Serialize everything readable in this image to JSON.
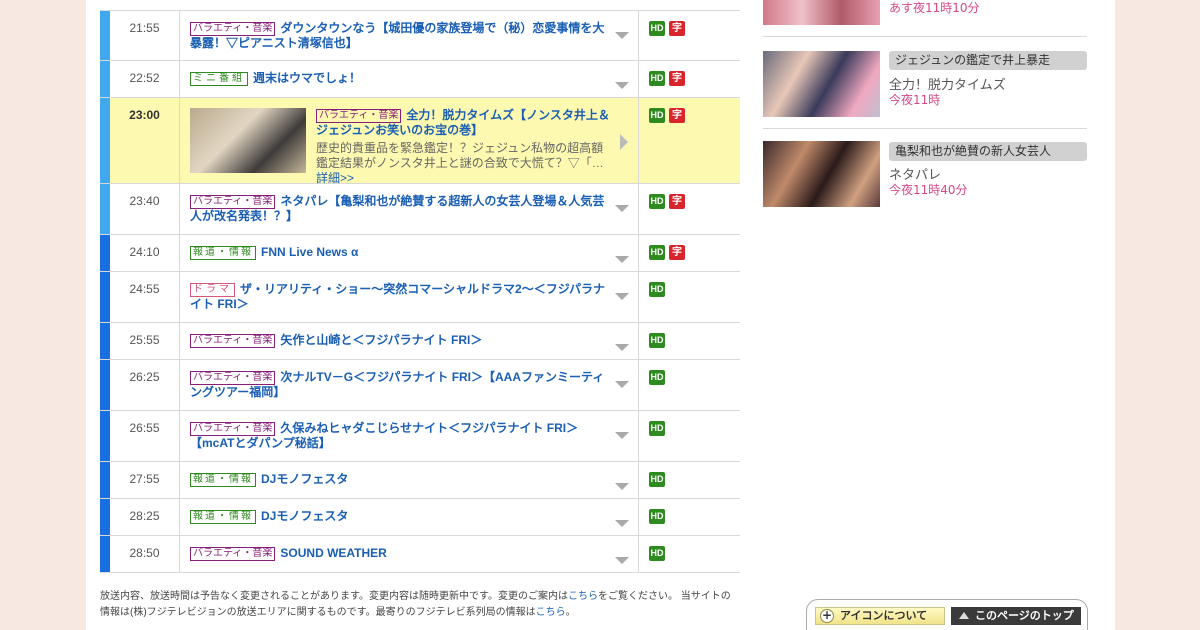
{
  "schedule": [
    {
      "time": "21:55",
      "bar": "#3fa8ef",
      "category": "バラエティ・音楽",
      "cat_class": "var",
      "title": "ダウンタウンなう【城田優の家族登場で（秘）恋愛事情を大暴露！▽ピアニスト清塚信也】",
      "hd": "HD",
      "ji": "字",
      "height": 51
    },
    {
      "time": "22:52",
      "bar": "#3fa8ef",
      "category": "ミニ番組",
      "cat_class": "mini",
      "title": "週末はウマでしょ！",
      "hd": "HD",
      "ji": "字",
      "height": 37
    },
    {
      "time": "23:00",
      "bar": "#3fa8ef",
      "category": "バラエティ・音楽",
      "cat_class": "var",
      "title": "全力！脱力タイムズ【ノンスタ井上＆ジェジュンお笑いのお宝の巻】",
      "desc": "歴史的貴重品を緊急鑑定！？ジェジュン私物の超高額鑑定結果がノンスタ井上と謎の合致で大慌て？▽「…",
      "more": "詳細>>",
      "hd": "HD",
      "ji": "字",
      "height": 86,
      "highlight": true
    },
    {
      "time": "23:40",
      "bar": "#3fa8ef",
      "category": "バラエティ・音楽",
      "cat_class": "var",
      "title": "ネタパレ【亀梨和也が絶賛する超新人の女芸人登場＆人気芸人が改名発表！？】",
      "hd": "HD",
      "ji": "字",
      "height": 51
    },
    {
      "time": "24:10",
      "bar": "#1a6fe0",
      "category": "報道・情報",
      "cat_class": "news",
      "title": "FNN Live News α",
      "hd": "HD",
      "ji": "字",
      "height": 37
    },
    {
      "time": "24:55",
      "bar": "#1a6fe0",
      "category": "ドラマ",
      "cat_class": "drama",
      "title": "ザ・リアリティ・ショー～突然コマーシャルドラマ2～＜フジパラナイト FRI＞",
      "hd": "HD",
      "ji": "",
      "height": 51
    },
    {
      "time": "25:55",
      "bar": "#1a6fe0",
      "category": "バラエティ・音楽",
      "cat_class": "var",
      "title": "矢作と山崎と＜フジパラナイト FRI＞",
      "hd": "HD",
      "ji": "",
      "height": 37
    },
    {
      "time": "26:25",
      "bar": "#1a6fe0",
      "category": "バラエティ・音楽",
      "cat_class": "var",
      "title": "次ナルTV－G＜フジパラナイト FRI＞【AAAファンミーティングツアー福岡】",
      "hd": "HD",
      "ji": "",
      "height": 51
    },
    {
      "time": "26:55",
      "bar": "#1a6fe0",
      "category": "バラエティ・音楽",
      "cat_class": "var",
      "title": "久保みねヒャダこじらせナイト＜フジパラナイト FRI＞【mcATとダパンプ秘話】",
      "hd": "HD",
      "ji": "",
      "height": 51
    },
    {
      "time": "27:55",
      "bar": "#1a6fe0",
      "category": "報道・情報",
      "cat_class": "news",
      "title": "DJモノフェスタ",
      "hd": "HD",
      "ji": "",
      "height": 37
    },
    {
      "time": "28:25",
      "bar": "#1a6fe0",
      "category": "報道・情報",
      "cat_class": "news",
      "title": "DJモノフェスタ",
      "hd": "HD",
      "ji": "",
      "height": 37
    },
    {
      "time": "28:50",
      "bar": "#1a6fe0",
      "category": "バラエティ・音楽",
      "cat_class": "var",
      "title": "SOUND WEATHER",
      "hd": "HD",
      "ji": "",
      "height": 37
    }
  ],
  "notice": {
    "text1": "放送内容、放送時間は予告なく変更されることがあります。変更内容は随時更新中です。変更のご案内は",
    "link1": "こちら",
    "text2": "をご覧ください。 当サイトの情報は(株)フジテレビジョンの放送エリアに関するものです。最寄りのフジテレビ系列局の情報は",
    "link2": "こちら",
    "text3": "。"
  },
  "sidebar": {
    "cards": [
      {
        "tag": "",
        "name": "",
        "when": "あす夜11時10分"
      },
      {
        "tag": "ジェジュンの鑑定で井上暴走",
        "name": "全力！脱力タイムズ",
        "when": "今夜11時"
      },
      {
        "tag": "亀梨和也が絶賛の新人女芸人",
        "name": "ネタパレ",
        "when": "今夜11時40分"
      }
    ]
  },
  "footer_buttons": {
    "icons_label": "アイコンについて",
    "top_label": "このページのトップ"
  }
}
